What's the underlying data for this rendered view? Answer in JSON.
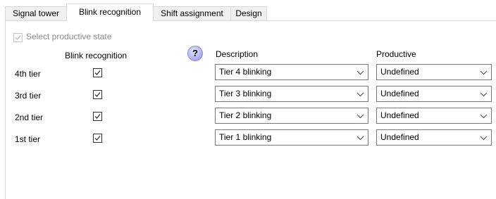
{
  "tabs": [
    {
      "label": "Signal tower",
      "active": false
    },
    {
      "label": "Blink recognition",
      "active": true
    },
    {
      "label": "Shift assignment",
      "active": false
    },
    {
      "label": "Design",
      "active": false
    }
  ],
  "select_productive": {
    "label": "Select productive state",
    "checked": true,
    "enabled": false
  },
  "columns": {
    "blink_recognition": "Blink recognition",
    "help": "?",
    "description": "Description",
    "productive": "Productive"
  },
  "rows": [
    {
      "label": "4th tier",
      "blink_checked": true,
      "description": "Tier 4 blinking",
      "productive": "Undefined"
    },
    {
      "label": "3rd tier",
      "blink_checked": true,
      "description": "Tier 3 blinking",
      "productive": "Undefined"
    },
    {
      "label": "2nd tier",
      "blink_checked": true,
      "description": "Tier 2 blinking",
      "productive": "Undefined"
    },
    {
      "label": "1st tier",
      "blink_checked": true,
      "description": "Tier 1 blinking",
      "productive": "Undefined"
    }
  ],
  "colors": {
    "accent": "#8b8bd6",
    "border": "#7a7a7a",
    "tab_bg": "#f0f0f0"
  }
}
